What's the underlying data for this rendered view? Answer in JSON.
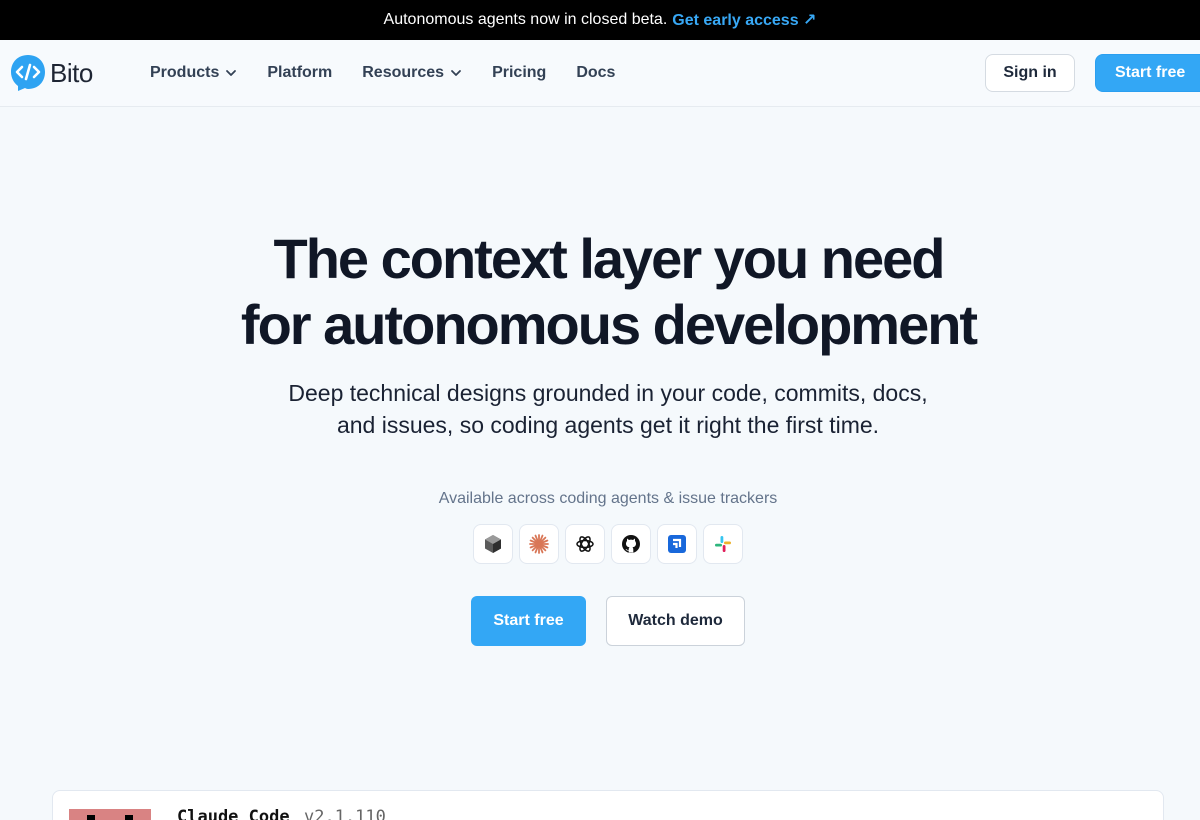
{
  "announcement": {
    "text": "Autonomous agents now in closed beta.",
    "link": "Get early access ↗"
  },
  "nav": {
    "logo_text": "Bito",
    "items": [
      {
        "label": "Products",
        "dropdown": true
      },
      {
        "label": "Platform",
        "dropdown": false
      },
      {
        "label": "Resources",
        "dropdown": true
      },
      {
        "label": "Pricing",
        "dropdown": false
      },
      {
        "label": "Docs",
        "dropdown": false
      }
    ],
    "signin": "Sign in",
    "start_free": "Start free"
  },
  "hero": {
    "title_line1": "The context layer you need",
    "title_line2": "for autonomous development",
    "subtitle_line1": "Deep technical designs grounded in your code, commits, docs,",
    "subtitle_line2": "and issues, so coding agents get it right the first time.",
    "available": "Available across coding agents & issue trackers",
    "integrations": [
      "cube-icon",
      "claude-icon",
      "openai-icon",
      "github-icon",
      "jira-icon",
      "slack-icon"
    ],
    "cta_primary": "Start free",
    "cta_secondary": "Watch demo"
  },
  "terminal": {
    "title": "Claude Code",
    "version": "v2.1.110"
  },
  "colors": {
    "accent": "#33a7f5",
    "link": "#38a8f5",
    "dark_text": "#101726"
  }
}
